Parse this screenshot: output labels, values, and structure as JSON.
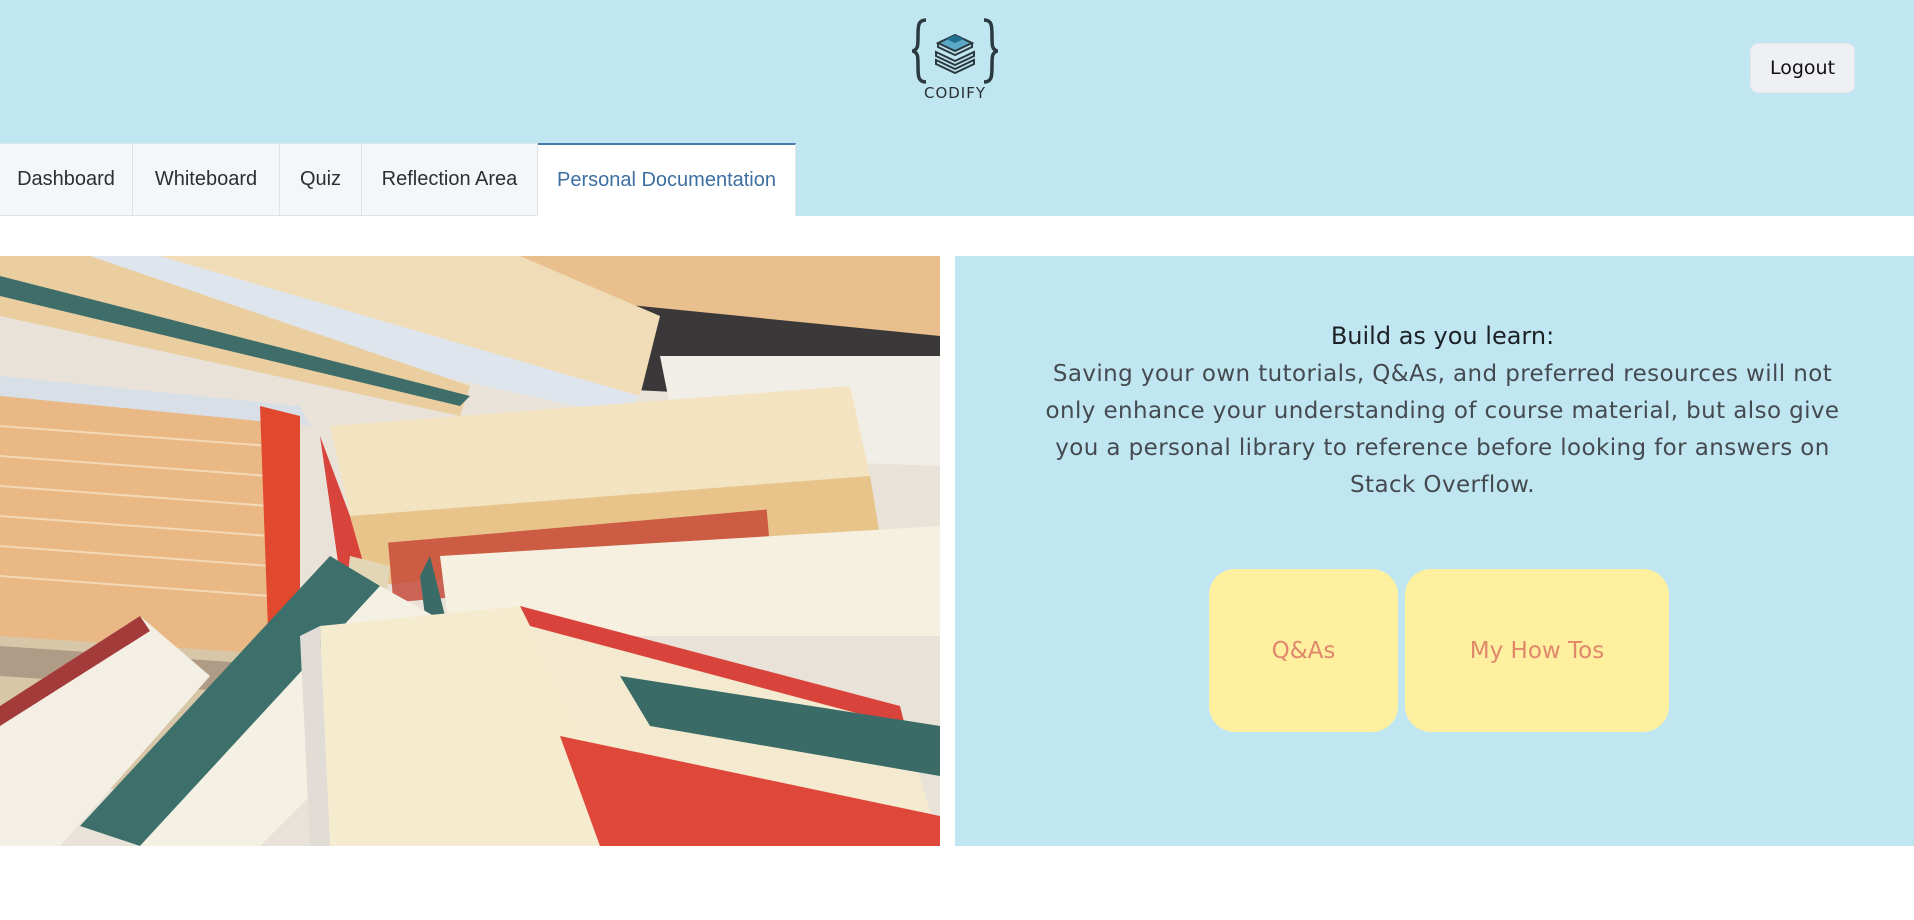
{
  "header": {
    "logo_text": "CODIFY",
    "logout_label": "Logout"
  },
  "tabs": [
    {
      "label": "Dashboard"
    },
    {
      "label": "Whiteboard"
    },
    {
      "label": "Quiz"
    },
    {
      "label": "Reflection Area"
    },
    {
      "label": "Personal Documentation",
      "active": true
    }
  ],
  "intro": {
    "title": "Build as you learn:",
    "body": "Saving your own tutorials, Q&As, and preferred resources will not only enhance your understanding of course material, but also give you a personal library to reference before looking for answers on Stack Overflow."
  },
  "cards": [
    {
      "label": "Q&As"
    },
    {
      "label": "My How Tos"
    }
  ],
  "colors": {
    "header_bg": "#c0e7f1",
    "card_bg": "#fef09f",
    "card_text": "#e0876c",
    "active_tab": "#3d6fa3"
  }
}
